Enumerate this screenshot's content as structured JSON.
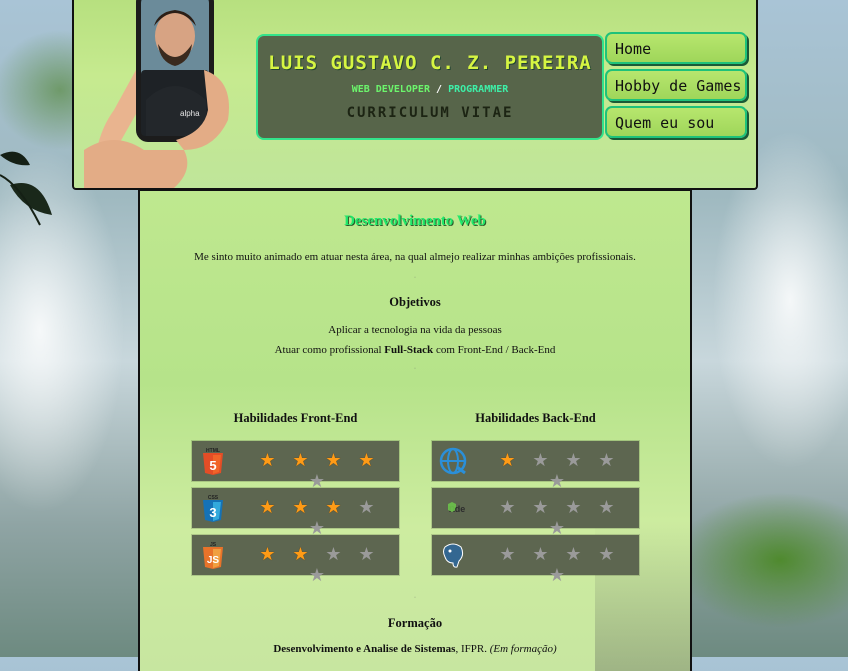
{
  "header": {
    "name": "LUIS GUSTAVO C. Z. PEREIRA",
    "role_left": "WEB DEVELOPER",
    "role_sep": "/",
    "role_right": "PROGRAMMER",
    "subtitle": "CURRICULUM VITAE"
  },
  "nav": [
    {
      "label": "Home"
    },
    {
      "label": "Hobby de Games"
    },
    {
      "label": "Quem eu sou"
    }
  ],
  "main": {
    "section_title": "Desenvolvimento Web",
    "intro": "Me sinto muito animado em atuar nesta área, na qual almejo realizar minhas ambições profissionais.",
    "objectives_title": "Objetivos",
    "objective_1": "Aplicar a tecnologia na vida da pessoas",
    "objective_2_pre": "Atuar como profissional ",
    "objective_2_bold": "Full-Stack",
    "objective_2_post": " com Front-End / Back-End",
    "frontend_title": "Habilidades Front-End",
    "backend_title": "Habilidades Back-End",
    "formation_title": "Formação",
    "formation_bold": "Desenvolvimento e Analise de Sistemas",
    "formation_inst": ", IFPR. ",
    "formation_status": "(Em formação)"
  },
  "skills": {
    "frontend": [
      {
        "icon": "html5-icon",
        "badge": "HTML",
        "glyph": "5",
        "rating": 4,
        "max": 5
      },
      {
        "icon": "css3-icon",
        "badge": "CSS",
        "glyph": "3",
        "rating": 3,
        "max": 5
      },
      {
        "icon": "javascript-icon",
        "badge": "JS",
        "glyph": "JS",
        "rating": 2,
        "max": 5
      }
    ],
    "backend": [
      {
        "icon": "web-globe-icon",
        "rating": 1,
        "max": 5
      },
      {
        "icon": "nodejs-icon",
        "rating": 0,
        "max": 5
      },
      {
        "icon": "postgresql-icon",
        "rating": 0,
        "max": 5
      }
    ]
  },
  "colors": {
    "star_on": "#ff9b16",
    "star_off": "#9a9a9a",
    "accent_green": "#1fe86a"
  }
}
